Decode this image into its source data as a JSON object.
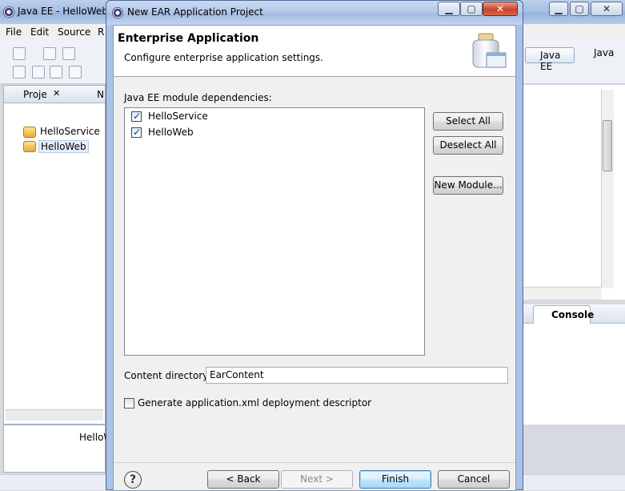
{
  "background_window": {
    "title": "Java EE - HelloWeb/",
    "menu": [
      "File",
      "Edit",
      "Source",
      "R"
    ],
    "perspectives": [
      "Java EE",
      "Java"
    ],
    "project_explorer": {
      "tab_label": "Proje",
      "second_tab_label": "N",
      "items": [
        "HelloService",
        "HelloWeb"
      ]
    },
    "bottom_panel_item": "HelloW",
    "console_tab_label": "Console"
  },
  "dialog": {
    "title": "New EAR Application Project",
    "heading": "Enterprise Application",
    "subheading": "Configure enterprise application settings.",
    "deps_label": "Java EE module dependencies:",
    "modules": [
      {
        "label": "HelloService",
        "checked": true
      },
      {
        "label": "HelloWeb",
        "checked": true
      }
    ],
    "buttons": {
      "select_all": "Select All",
      "deselect_all": "Deselect All",
      "new_module": "New Module...",
      "back": "< Back",
      "next": "Next >",
      "finish": "Finish",
      "cancel": "Cancel"
    },
    "content_dir_label": "Content directory:",
    "content_dir_value": "EarContent",
    "generate_descriptor_label": "Generate application.xml deployment descriptor",
    "generate_descriptor_checked": false,
    "help_glyph": "?"
  },
  "icons": {
    "check": "✓",
    "minimize": "▁",
    "maximize": "▢",
    "close": "✕",
    "tab_close": "✕",
    "help": "help-icon"
  }
}
